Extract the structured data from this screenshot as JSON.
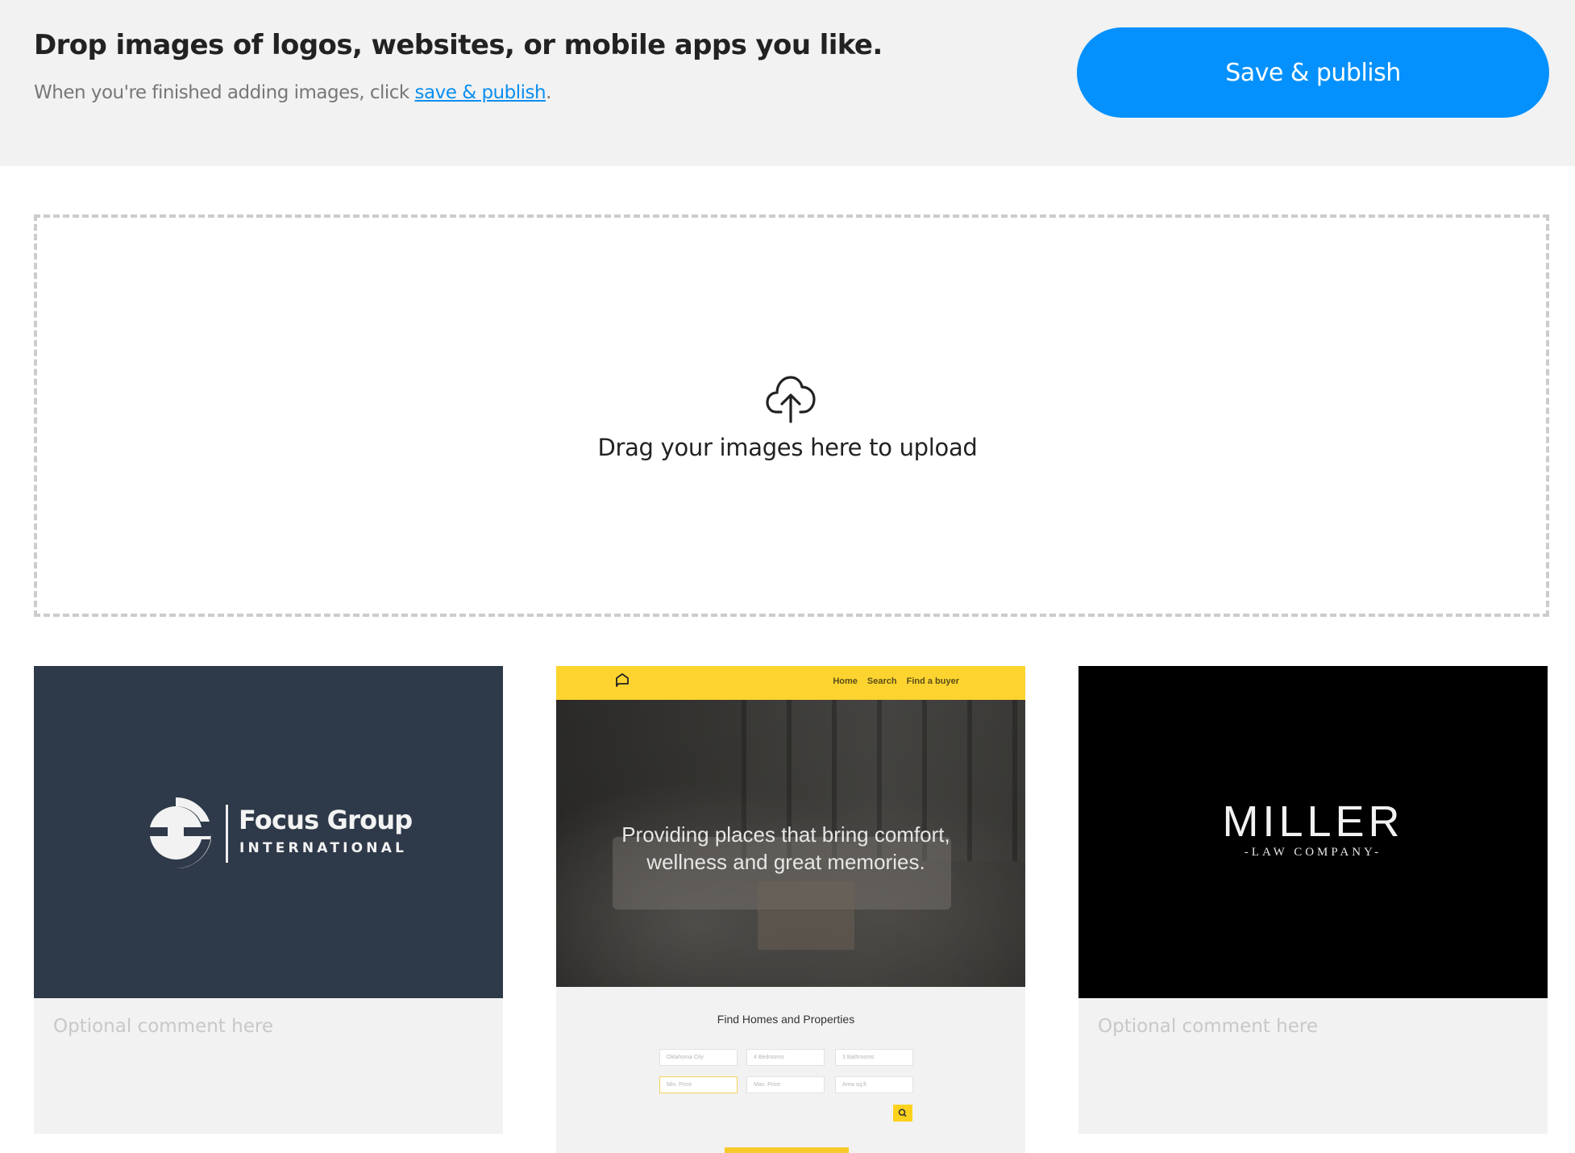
{
  "header": {
    "title": "Drop images of logos, websites, or mobile apps you like.",
    "subtitle_prefix": "When you're finished adding images, click ",
    "subtitle_link": "save & publish",
    "subtitle_suffix": ".",
    "publish_button": "Save & publish"
  },
  "dropzone": {
    "icon": "cloud-upload-icon",
    "text": "Drag your images here to upload"
  },
  "colors": {
    "accent": "#0591fd",
    "link": "#0a8ef0",
    "header_bg": "#f2f2f2",
    "dropzone_border": "#cccccc"
  },
  "cards": [
    {
      "type": "logo",
      "brand_name": "Focus Group",
      "brand_sub": "INTERNATIONAL",
      "comment_placeholder": "Optional comment here",
      "comment_value": ""
    },
    {
      "type": "website",
      "nav_links": [
        "Home",
        "Search",
        "Find a buyer"
      ],
      "hero_line1": "Providing places that bring comfort,",
      "hero_line2": "wellness and great memories.",
      "section_title": "Find Homes and Properties",
      "inputs": [
        "Oklahoma City",
        "4 Bedrooms",
        "3 Bathrooms",
        "Min. Price",
        "Max. Price",
        "Area sq.ft"
      ]
    },
    {
      "type": "logo",
      "brand_name": "MILLER",
      "brand_sub": "-LAW COMPANY-",
      "comment_placeholder": "Optional comment here",
      "comment_value": ""
    }
  ]
}
